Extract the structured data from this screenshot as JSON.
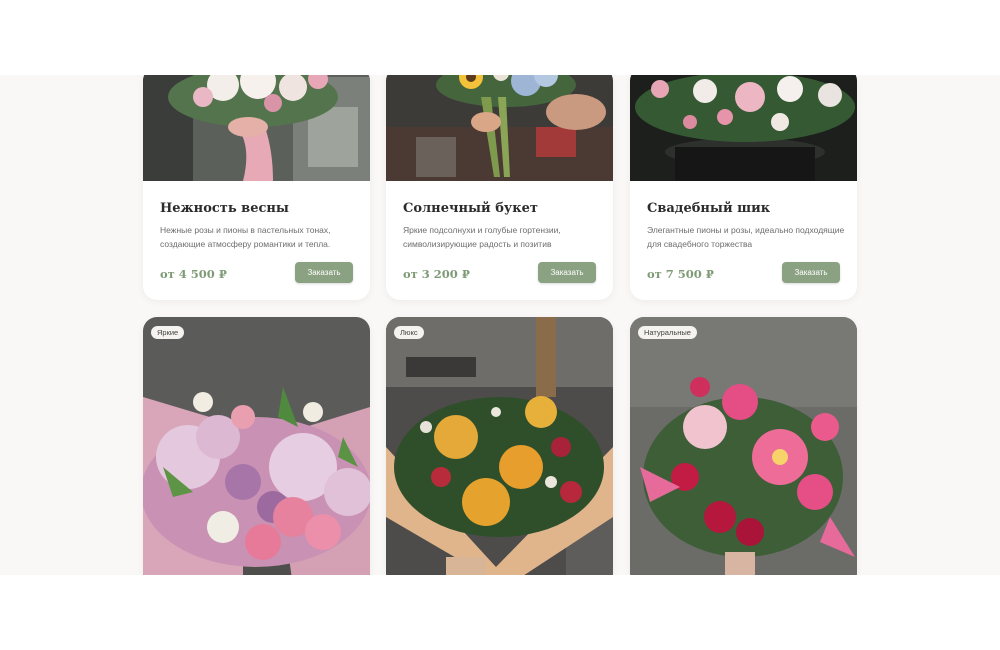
{
  "products": [
    {
      "title": "Нежность весны",
      "description": "Нежные розы и пионы в пастельных тонах, создающие атмосферу романтики и тепла.",
      "price": "от 4 500 ₽",
      "button": "Заказать",
      "image": "bouquet-pastel-photo"
    },
    {
      "title": "Солнечный букет",
      "description": "Яркие подсолнухи и голубые гортензии, символизирующие радость и позитив",
      "price": "от 3 200 ₽",
      "button": "Заказать",
      "image": "bouquet-sunflower-photo"
    },
    {
      "title": "Свадебный шик",
      "description": "Элегантные пионы и розы, идеально подходящие для свадебного торжества",
      "price": "от 7 500 ₽",
      "button": "Заказать",
      "image": "bouquet-wedding-photo"
    }
  ],
  "gallery": [
    {
      "badge": "Яркие",
      "image": "bouquet-pink-hydrangea-photo"
    },
    {
      "badge": "Люкс",
      "image": "bouquet-protea-photo"
    },
    {
      "badge": "Натуральные",
      "image": "bouquet-gerbera-photo"
    }
  ],
  "colors": {
    "accent": "#8aa282",
    "price": "#7f9a76",
    "background": "#faf8f6"
  }
}
